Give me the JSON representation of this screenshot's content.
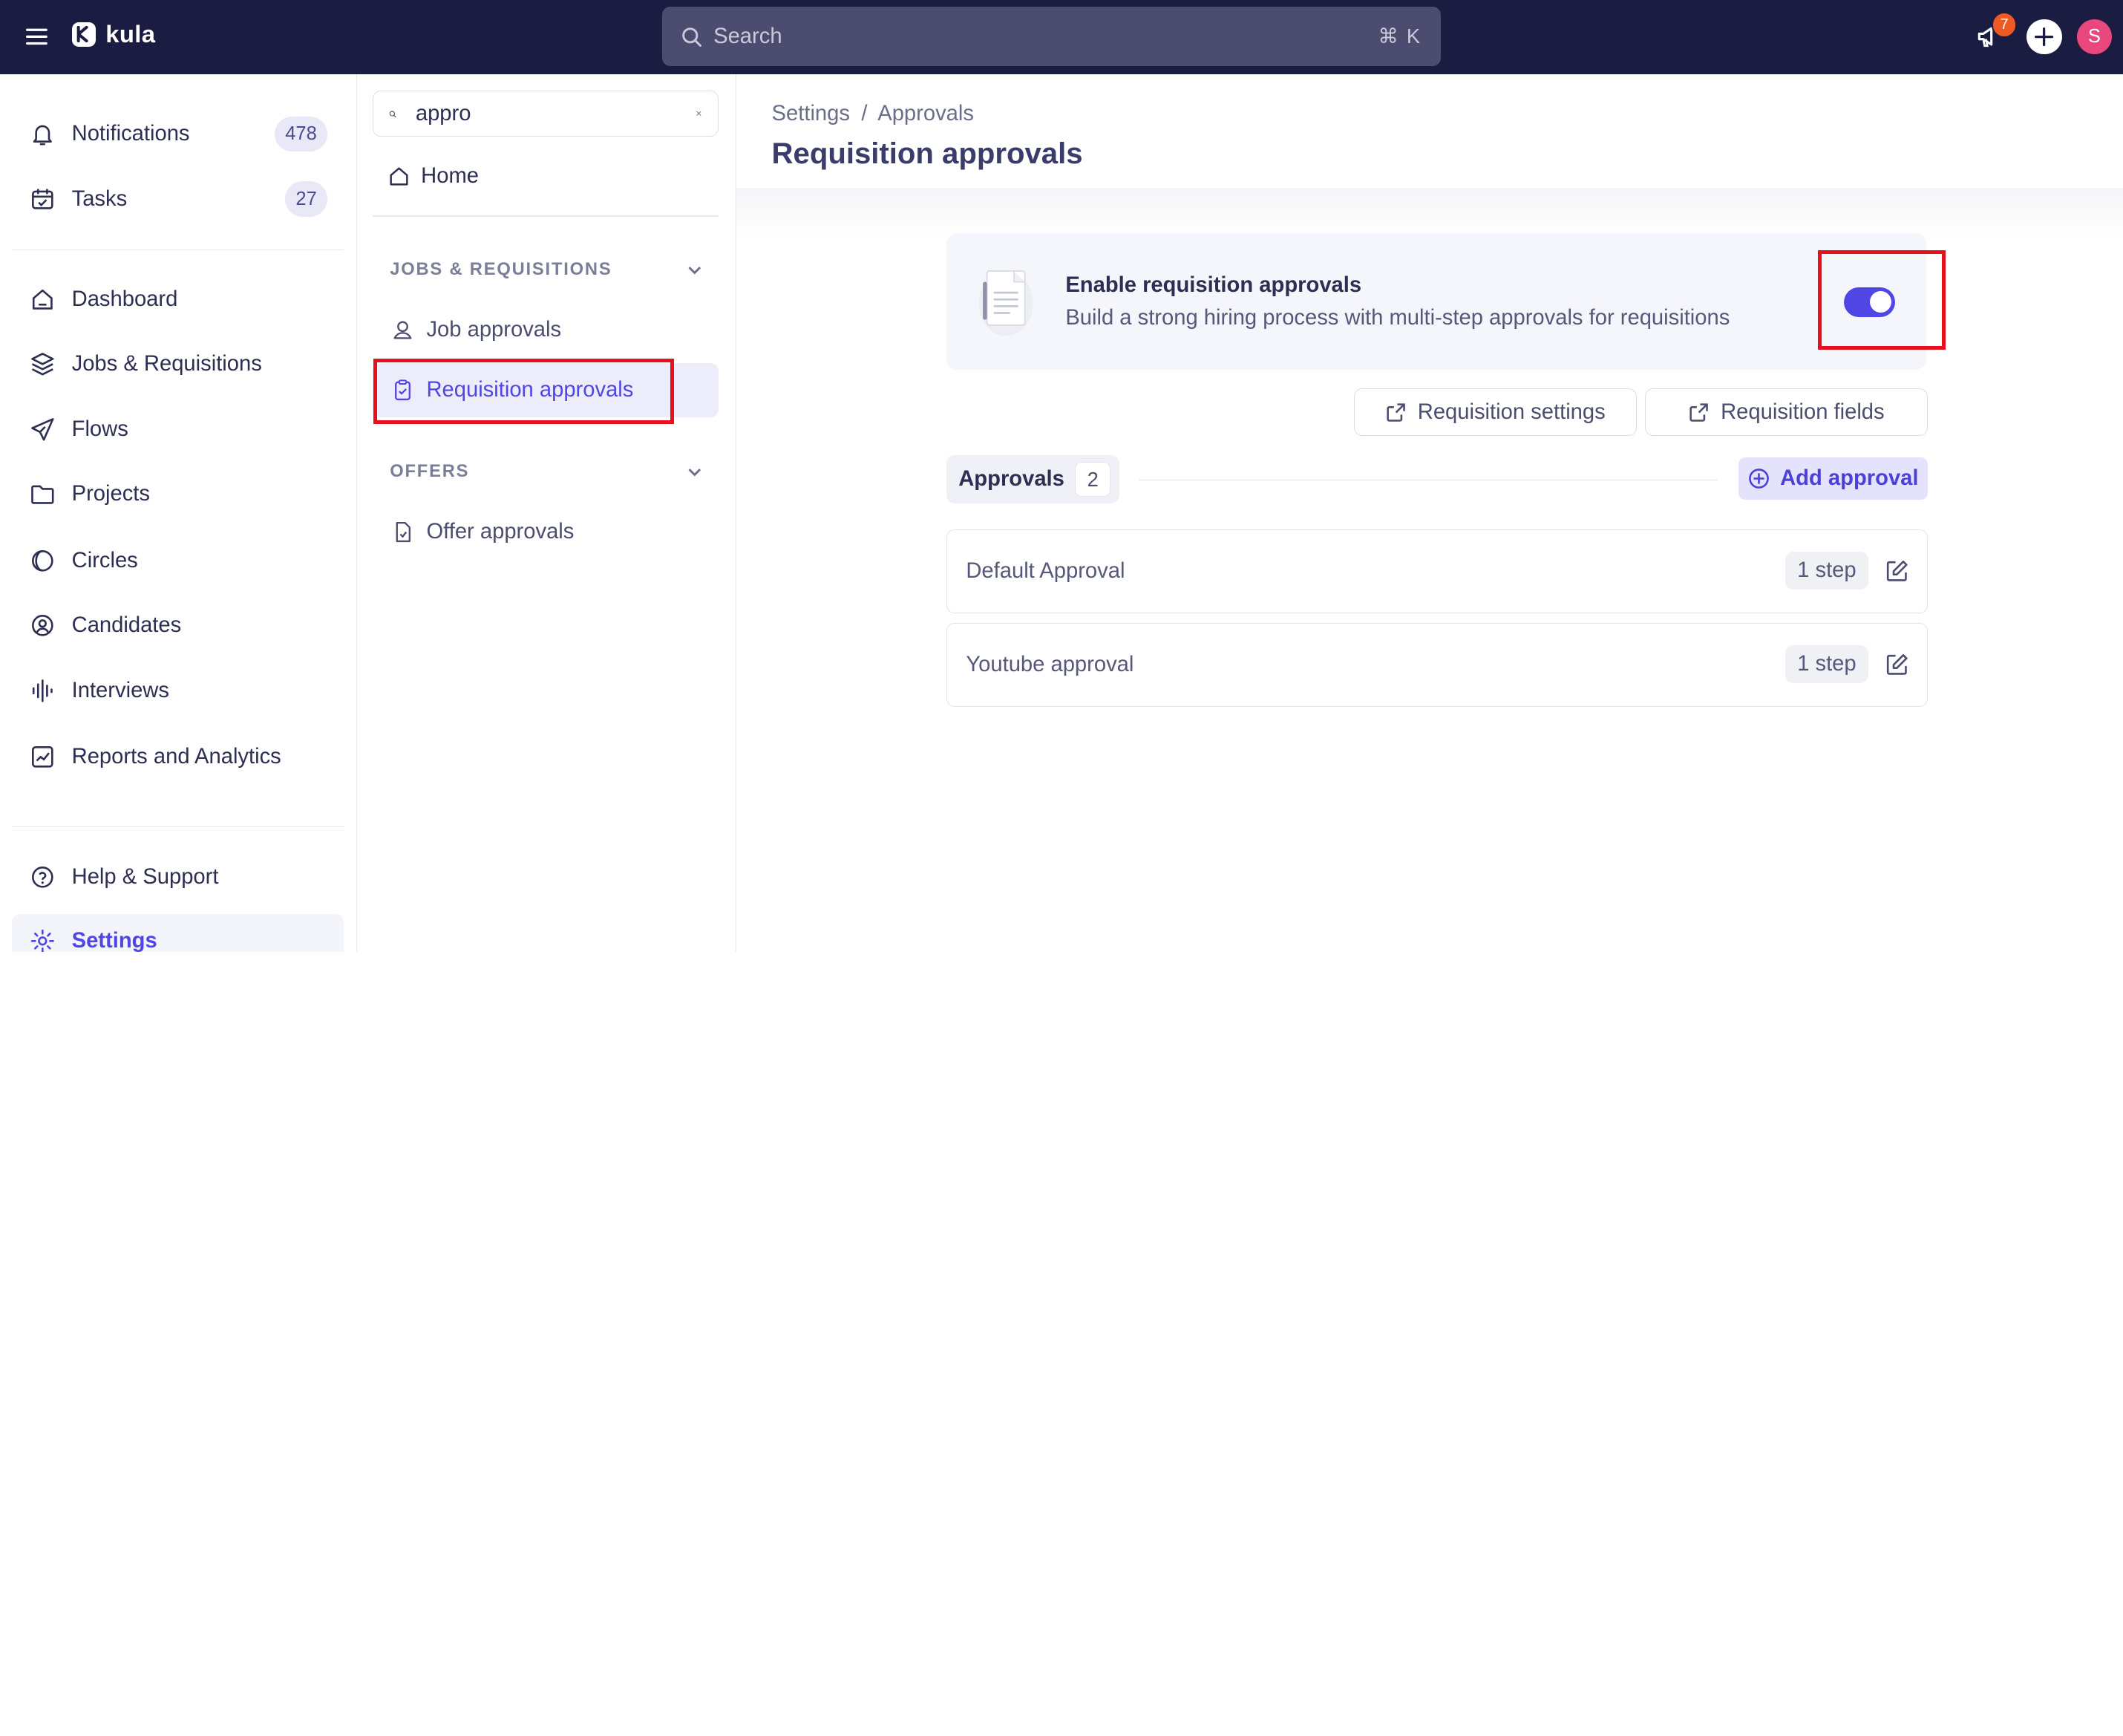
{
  "app": {
    "name": "kula"
  },
  "topbar": {
    "search_placeholder": "Search",
    "search_shortcut": "⌘ K",
    "notification_badge": "7",
    "avatar_initial": "S",
    "colors": {
      "bar": "#1b1c42",
      "badge": "#ee5a24",
      "avatar": "#e8487c"
    }
  },
  "sidebar": {
    "items": [
      {
        "label": "Notifications",
        "count": "478",
        "icon": "bell-icon"
      },
      {
        "label": "Tasks",
        "count": "27",
        "icon": "calendar-check-icon"
      },
      {
        "label": "Dashboard",
        "icon": "home-icon"
      },
      {
        "label": "Jobs & Requisitions",
        "icon": "layers-icon"
      },
      {
        "label": "Flows",
        "icon": "send-icon"
      },
      {
        "label": "Projects",
        "icon": "folder-icon"
      },
      {
        "label": "Circles",
        "icon": "circles-icon"
      },
      {
        "label": "Candidates",
        "icon": "user-circle-icon"
      },
      {
        "label": "Interviews",
        "icon": "audio-wave-icon"
      },
      {
        "label": "Reports and Analytics",
        "icon": "chart-icon"
      }
    ],
    "footer": [
      {
        "label": "Help & Support",
        "icon": "help-circle-icon"
      },
      {
        "label": "Settings",
        "icon": "gear-icon",
        "active": true
      }
    ]
  },
  "subnav": {
    "search_value": "appro",
    "home_label": "Home",
    "groups": [
      {
        "title": "JOBS & REQUISITIONS",
        "items": [
          {
            "label": "Job approvals",
            "icon": "user-badge-icon"
          },
          {
            "label": "Requisition approvals",
            "icon": "clipboard-check-icon",
            "active": true
          }
        ]
      },
      {
        "title": "OFFERS",
        "items": [
          {
            "label": "Offer approvals",
            "icon": "file-check-icon"
          }
        ]
      }
    ]
  },
  "main": {
    "breadcrumb": {
      "root": "Settings",
      "separator": "/",
      "current": "Approvals"
    },
    "title": "Requisition approvals",
    "enable_card": {
      "title": "Enable requisition approvals",
      "description": "Build a strong hiring process with multi-step approvals for requisitions",
      "enabled": true
    },
    "buttons": {
      "requisition_settings": "Requisition settings",
      "requisition_fields": "Requisition fields"
    },
    "approvals_tab": {
      "label": "Approvals",
      "count": "2"
    },
    "add_approval_label": "Add approval",
    "approvals": [
      {
        "name": "Default Approval",
        "steps": "1 step"
      },
      {
        "name": "Youtube approval",
        "steps": "1 step"
      }
    ],
    "accent_color": "#5046e5"
  }
}
